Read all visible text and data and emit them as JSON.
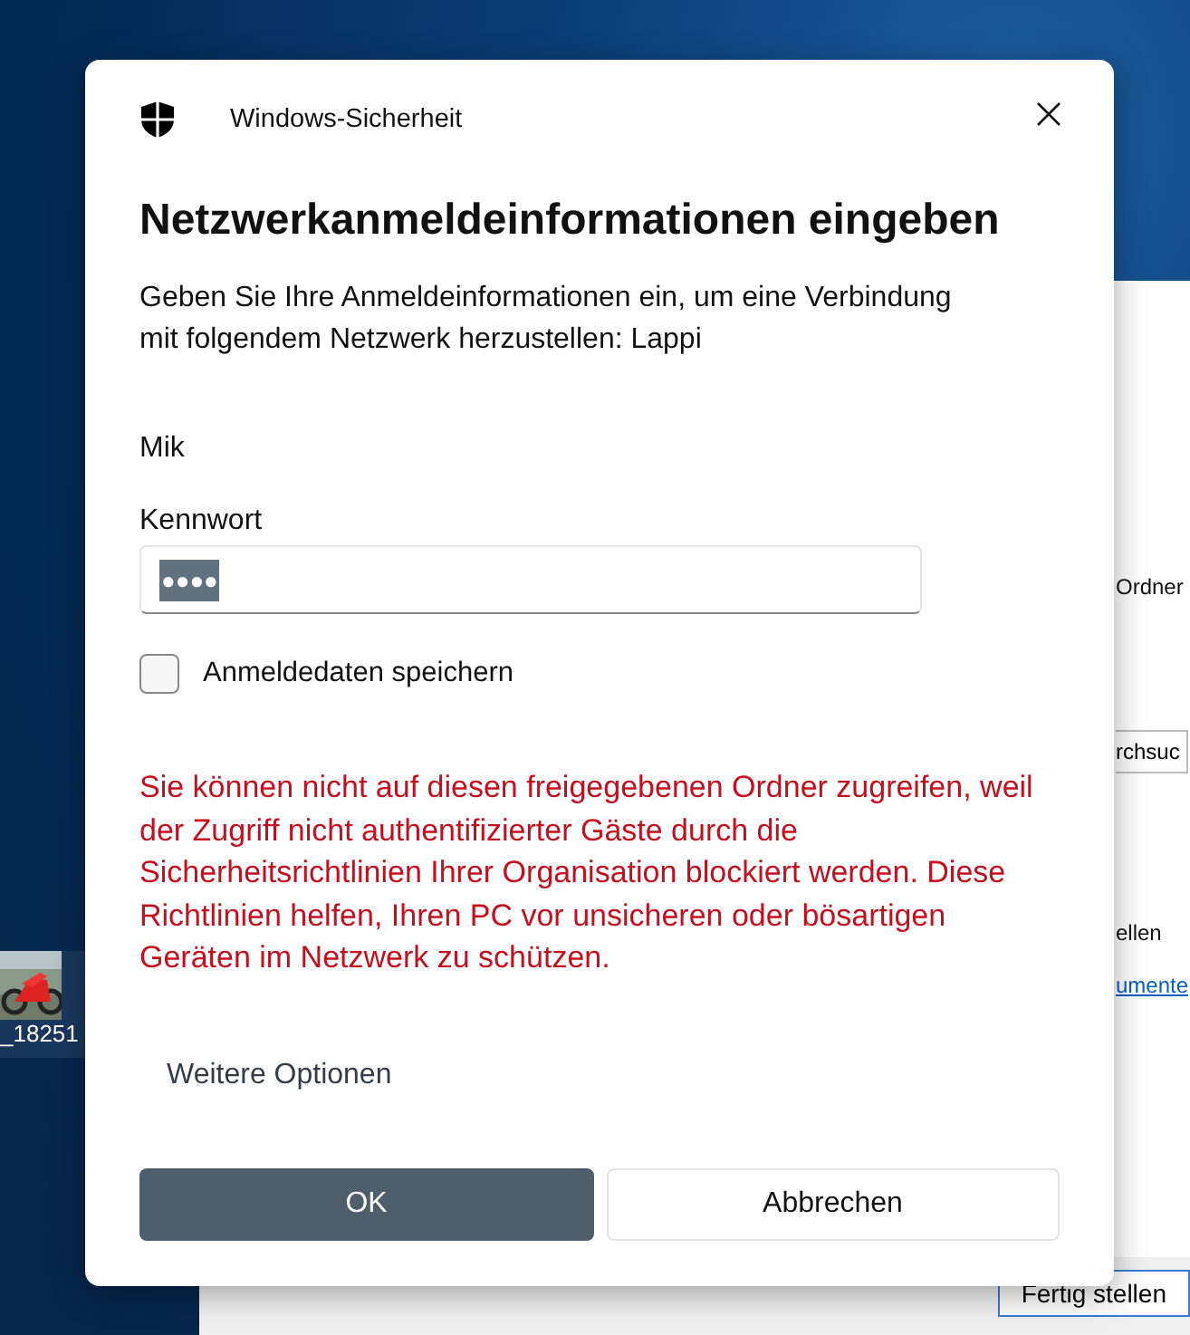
{
  "desktop": {
    "icon": {
      "label": "_18251",
      "kind": "picture"
    }
  },
  "background_window": {
    "items": [
      {
        "kind": "text",
        "text": "Ordner"
      },
      {
        "kind": "button",
        "text": "rchsuc"
      },
      {
        "kind": "text",
        "text": "ellen"
      },
      {
        "kind": "link",
        "text": "umente"
      }
    ],
    "finish_button": "Fertig stellen"
  },
  "dialog": {
    "app_name": "Windows-Sicherheit",
    "title": "Netzwerkanmeldeinformationen eingeben",
    "message": "Geben Sie Ihre Anmeldeinformationen ein, um eine Verbindung mit folgendem Netzwerk herzustellen: Lappi",
    "username": "Mik",
    "password": {
      "label": "Kennwort",
      "value": "●●●●",
      "selected": true
    },
    "remember": {
      "label": "Anmeldedaten speichern",
      "checked": false
    },
    "error": "Sie können nicht auf diesen freigegebenen Ordner zugreifen, weil der Zugriff nicht authentifizierter Gäste durch die Sicherheitsrichtlinien Ihrer Organisation blockiert werden. Diese Richtlinien helfen, Ihren PC vor unsicheren oder bösartigen Geräten im Netzwerk zu schützen.",
    "more_options": "Weitere Optionen",
    "buttons": [
      {
        "label": "OK",
        "kind": "primary"
      },
      {
        "label": "Abbrechen",
        "kind": "secondary"
      }
    ]
  }
}
